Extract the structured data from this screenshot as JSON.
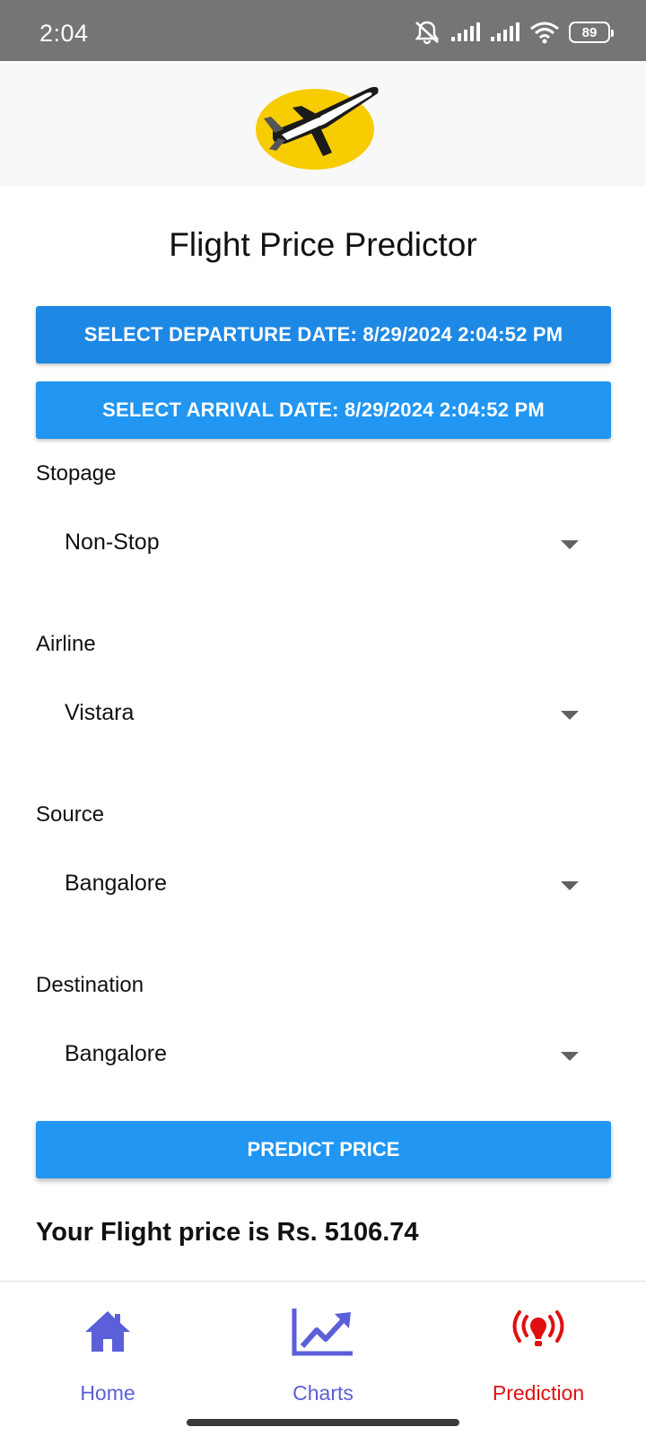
{
  "status_bar": {
    "time": "2:04",
    "battery": "89",
    "icons": [
      "mute-bell-icon",
      "signal-icon",
      "signal-icon",
      "wifi-icon",
      "battery-icon"
    ]
  },
  "header": {
    "logo": "airplane-logo"
  },
  "page": {
    "title": "Flight Price Predictor"
  },
  "buttons": {
    "departure": "SELECT DEPARTURE DATE: 8/29/2024 2:04:52 PM",
    "arrival": "SELECT ARRIVAL DATE: 8/29/2024 2:04:52 PM",
    "predict": "PREDICT PRICE"
  },
  "fields": {
    "stopage": {
      "label": "Stopage",
      "value": "Non-Stop"
    },
    "airline": {
      "label": "Airline",
      "value": "Vistara"
    },
    "source": {
      "label": "Source",
      "value": "Bangalore"
    },
    "destination": {
      "label": "Destination",
      "value": "Bangalore"
    }
  },
  "result": {
    "text": "Your Flight price is Rs. 5106.74"
  },
  "nav": {
    "items": [
      {
        "label": "Home",
        "icon": "home-icon",
        "color": "#5b5fd8",
        "active": false
      },
      {
        "label": "Charts",
        "icon": "chart-icon",
        "color": "#5b5fd8",
        "active": false
      },
      {
        "label": "Prediction",
        "icon": "broadcast-icon",
        "color": "#e01010",
        "active": true
      }
    ]
  },
  "colors": {
    "primary_button": "#2196f3",
    "status_bar": "#757575",
    "nav_inactive": "#5b5fd8",
    "nav_active": "#e01010",
    "logo_yellow": "#f7cc00"
  }
}
